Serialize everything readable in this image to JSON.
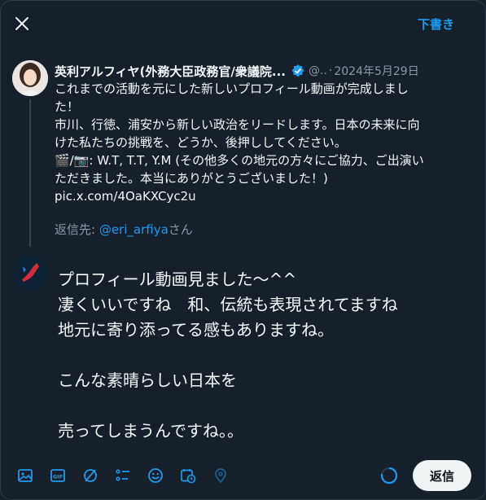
{
  "header": {
    "close_icon": "close-icon",
    "drafts_label": "下書き"
  },
  "tweet": {
    "author_name": "英利アルフィヤ(外務大臣政務官/衆議院...",
    "handle": "@..",
    "separator": "·",
    "date": "2024年5月29日",
    "lines": [
      "これまでの活動を元にした新しいプロフィール動画が完成しまし",
      "た！",
      "市川、行徳、浦安から新しい政治をリードします。日本の未来に向",
      "けた私たちの挑戦を、どうか、後押ししてください。",
      "🎬/📷: W.T, T.T, Y.M (その他多くの地元の方々にご協力、ご出演い",
      "ただきました。本当にありがとうございました！)",
      "pic.x.com/4OaKXCyc2u"
    ]
  },
  "replying": {
    "prefix": "返信先: ",
    "mention": "@eri_arfiya",
    "suffix": "さん"
  },
  "compose": {
    "lines": [
      "プロフィール動画見ました～^^",
      "凄くいいですね　和、伝統も表現されてますね",
      "地元に寄り添ってる感もありますね。",
      "",
      "こんな素晴らしい日本を",
      "",
      "売ってしまうんですね。。"
    ]
  },
  "toolbar": {
    "icons": [
      "image-icon",
      "gif-icon",
      "grok-icon",
      "poll-icon",
      "emoji-icon",
      "schedule-icon",
      "location-icon"
    ],
    "reply_label": "返信"
  },
  "colors": {
    "background": "#15202b",
    "accent": "#1d9bf0",
    "muted_text": "#8b98a5",
    "button_bg": "#eff3f4"
  }
}
